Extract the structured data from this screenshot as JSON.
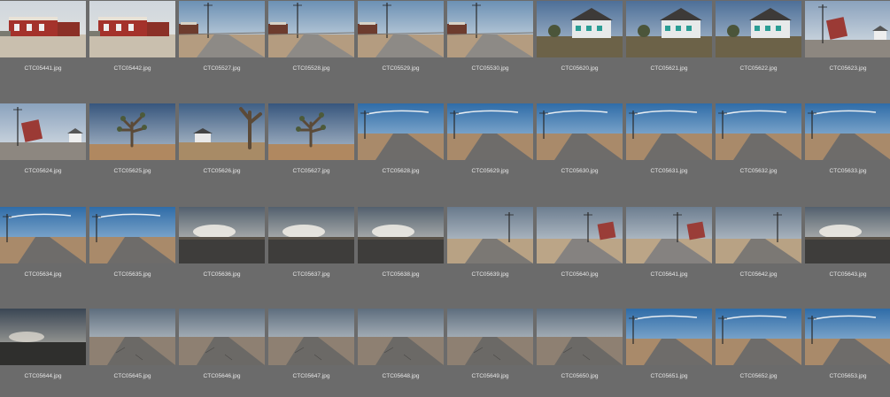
{
  "app": {
    "background": "#6b6b6b",
    "label_color": "#e8e8e8"
  },
  "photos": [
    {
      "name": "CTC05441.jpg",
      "scene": "motel-building"
    },
    {
      "name": "CTC05442.jpg",
      "scene": "motel-building"
    },
    {
      "name": "CTC05527.jpg",
      "scene": "road-with-poles"
    },
    {
      "name": "CTC05528.jpg",
      "scene": "road-with-poles"
    },
    {
      "name": "CTC05529.jpg",
      "scene": "road-with-poles"
    },
    {
      "name": "CTC05530.jpg",
      "scene": "road-with-poles"
    },
    {
      "name": "CTC05620.jpg",
      "scene": "white-house"
    },
    {
      "name": "CTC05621.jpg",
      "scene": "white-house"
    },
    {
      "name": "CTC05622.jpg",
      "scene": "white-house"
    },
    {
      "name": "CTC05623.jpg",
      "scene": "sign-and-pole"
    },
    {
      "name": "CTC05624.jpg",
      "scene": "sign-and-pole"
    },
    {
      "name": "CTC05625.jpg",
      "scene": "joshua-tree"
    },
    {
      "name": "CTC05626.jpg",
      "scene": "joshua-tree-house"
    },
    {
      "name": "CTC05627.jpg",
      "scene": "joshua-tree"
    },
    {
      "name": "CTC05628.jpg",
      "scene": "blue-sky-road"
    },
    {
      "name": "CTC05629.jpg",
      "scene": "blue-sky-road"
    },
    {
      "name": "CTC05630.jpg",
      "scene": "blue-sky-road"
    },
    {
      "name": "CTC05631.jpg",
      "scene": "blue-sky-road"
    },
    {
      "name": "CTC05632.jpg",
      "scene": "blue-sky-road"
    },
    {
      "name": "CTC05633.jpg",
      "scene": "blue-sky-road"
    },
    {
      "name": "CTC05634.jpg",
      "scene": "blue-sky-road"
    },
    {
      "name": "CTC05635.jpg",
      "scene": "blue-sky-road"
    },
    {
      "name": "CTC05636.jpg",
      "scene": "sunset-flat"
    },
    {
      "name": "CTC05637.jpg",
      "scene": "sunset-flat"
    },
    {
      "name": "CTC05638.jpg",
      "scene": "sunset-flat"
    },
    {
      "name": "CTC05639.jpg",
      "scene": "cloudy-road-pole"
    },
    {
      "name": "CTC05640.jpg",
      "scene": "cloudy-road-sign"
    },
    {
      "name": "CTC05641.jpg",
      "scene": "cloudy-road-sign"
    },
    {
      "name": "CTC05642.jpg",
      "scene": "cloudy-road-pole"
    },
    {
      "name": "CTC05643.jpg",
      "scene": "sunset-flat"
    },
    {
      "name": "CTC05644.jpg",
      "scene": "dark-sunset"
    },
    {
      "name": "CTC05645.jpg",
      "scene": "cloudy-road"
    },
    {
      "name": "CTC05646.jpg",
      "scene": "cloudy-road"
    },
    {
      "name": "CTC05647.jpg",
      "scene": "cloudy-road"
    },
    {
      "name": "CTC05648.jpg",
      "scene": "cloudy-road"
    },
    {
      "name": "CTC05649.jpg",
      "scene": "cloudy-road"
    },
    {
      "name": "CTC05650.jpg",
      "scene": "cloudy-road"
    },
    {
      "name": "CTC05651.jpg",
      "scene": "blue-sky-road"
    },
    {
      "name": "CTC05652.jpg",
      "scene": "blue-sky-road"
    },
    {
      "name": "CTC05653.jpg",
      "scene": "blue-sky-road"
    }
  ]
}
